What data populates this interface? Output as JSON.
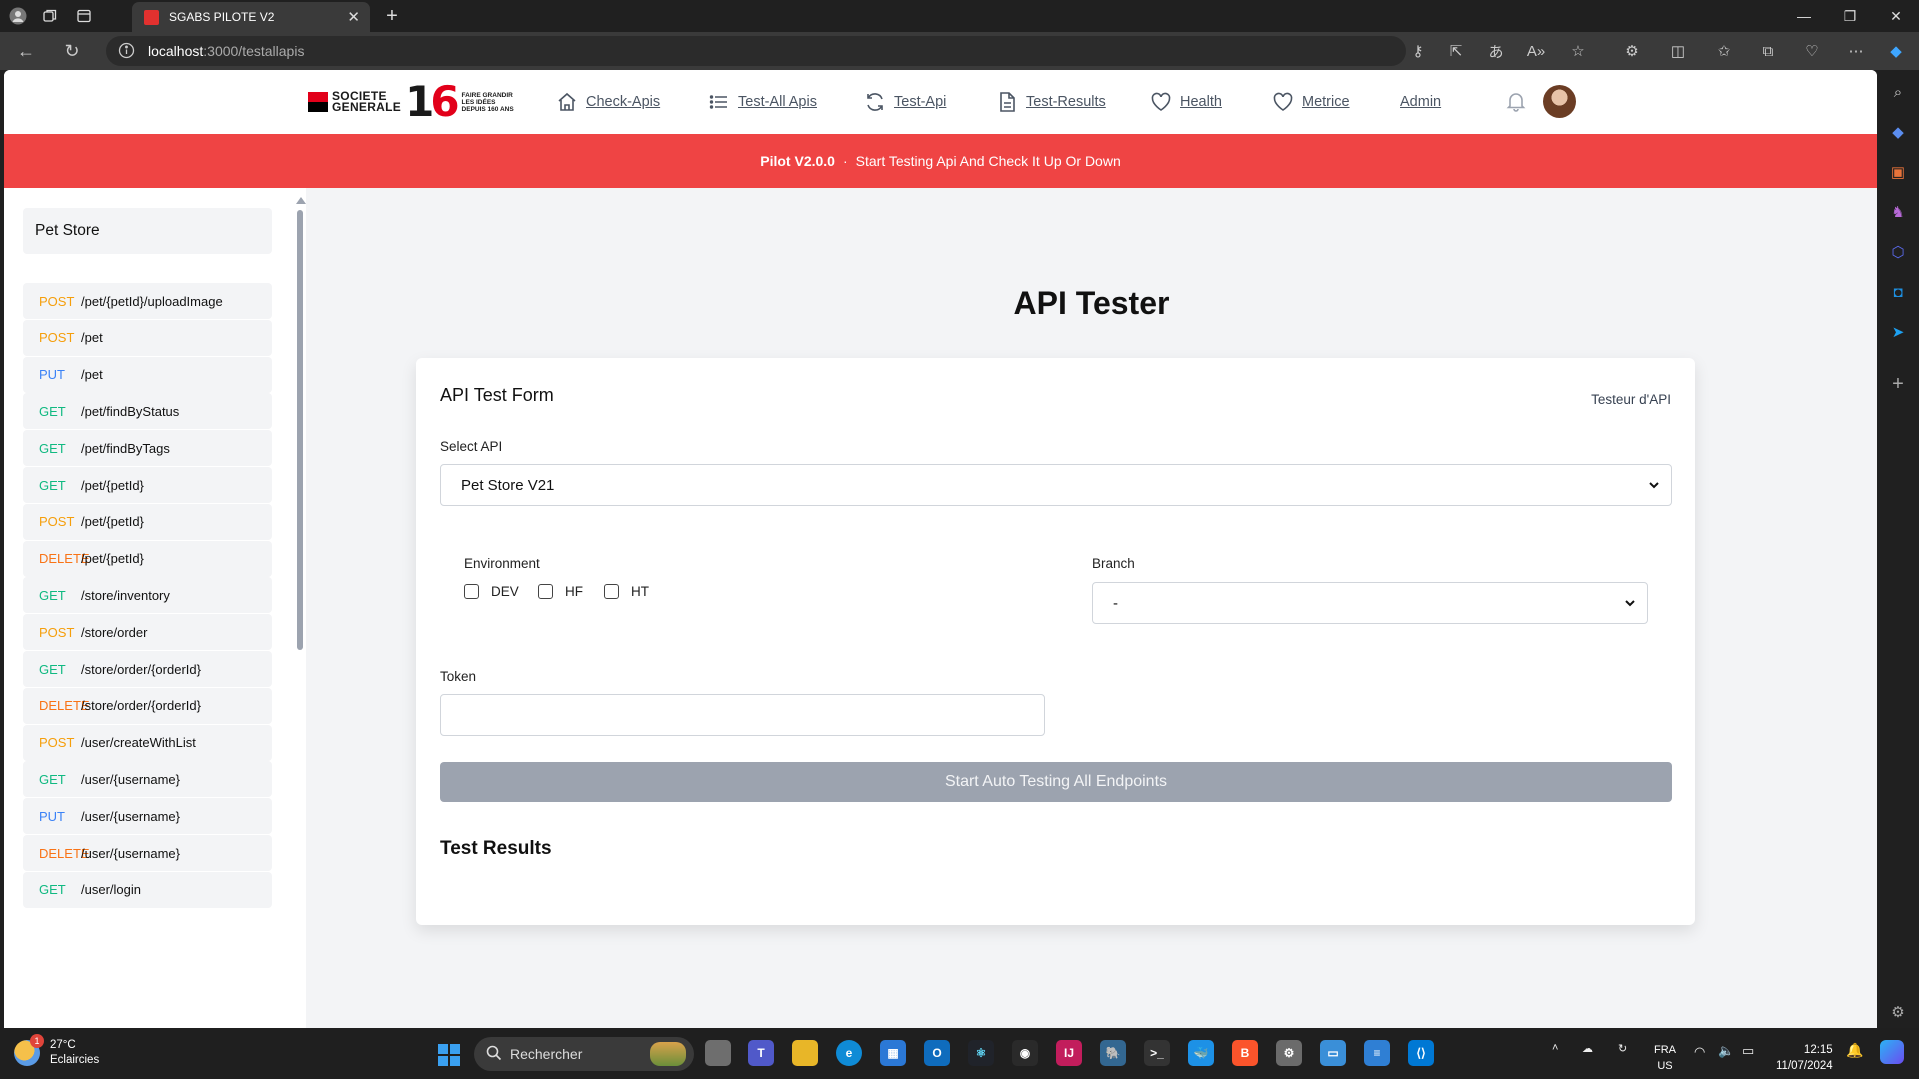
{
  "browser": {
    "tab_title": "SGABS PILOTE V2",
    "url_host": "localhost",
    "url_path": ":3000/testallapis"
  },
  "nav": {
    "logo_line1": "SOCIETE",
    "logo_line2": "GENERALE",
    "logo_number_1": "1",
    "logo_number_6": "6",
    "logo_sub1": "FAIRE GRANDIR",
    "logo_sub2": "LES IDÉES",
    "logo_sub3": "DEPUIS 160 ANS",
    "links": [
      {
        "label": "Check-Apis",
        "icon": "home-icon"
      },
      {
        "label": "Test-All Apis",
        "icon": "list-icon"
      },
      {
        "label": "Test-Api",
        "icon": "refresh-icon"
      },
      {
        "label": "Test-Results",
        "icon": "document-icon"
      },
      {
        "label": "Health",
        "icon": "heart-icon"
      },
      {
        "label": "Metrice",
        "icon": "heart-icon"
      },
      {
        "label": "Admin",
        "icon": ""
      }
    ]
  },
  "banner": {
    "version": "Pilot V2.0.0",
    "separator": "·",
    "message": "Start Testing Api And Check It Up Or Down"
  },
  "sidebar": {
    "title": "Pet Store",
    "endpoints": [
      {
        "method": "POST",
        "path": "/pet/{petId}/uploadImage"
      },
      {
        "method": "POST",
        "path": "/pet"
      },
      {
        "method": "PUT",
        "path": "/pet"
      },
      {
        "method": "GET",
        "path": "/pet/findByStatus"
      },
      {
        "method": "GET",
        "path": "/pet/findByTags"
      },
      {
        "method": "GET",
        "path": "/pet/{petId}"
      },
      {
        "method": "POST",
        "path": "/pet/{petId}"
      },
      {
        "method": "DELETE",
        "path": "/pet/{petId}"
      },
      {
        "method": "GET",
        "path": "/store/inventory"
      },
      {
        "method": "POST",
        "path": "/store/order"
      },
      {
        "method": "GET",
        "path": "/store/order/{orderId}"
      },
      {
        "method": "DELETE",
        "path": "/store/order/{orderId}"
      },
      {
        "method": "POST",
        "path": "/user/createWithList"
      },
      {
        "method": "GET",
        "path": "/user/{username}"
      },
      {
        "method": "PUT",
        "path": "/user/{username}"
      },
      {
        "method": "DELETE",
        "path": "/user/{username}"
      },
      {
        "method": "GET",
        "path": "/user/login"
      }
    ]
  },
  "main": {
    "title": "API Tester",
    "form": {
      "title": "API Test Form",
      "subtitle": "Testeur d'API",
      "select_api_label": "Select API",
      "select_api_value": "Pet Store V21",
      "environment_label": "Environment",
      "environments": [
        {
          "label": "DEV",
          "checked": false
        },
        {
          "label": "HF",
          "checked": false
        },
        {
          "label": "HT",
          "checked": false
        }
      ],
      "branch_label": "Branch",
      "branch_value": "-",
      "token_label": "Token",
      "token_value": "",
      "start_button": "Start Auto Testing All Endpoints",
      "results_title": "Test Results"
    }
  },
  "taskbar": {
    "weather_temp": "27°C",
    "weather_desc": "Eclaircies",
    "weather_badge": "1",
    "search_placeholder": "Rechercher",
    "lang_line1": "FRA",
    "lang_line2": "US",
    "time": "12:15",
    "date": "11/07/2024"
  },
  "colors": {
    "banner": "#ef4444",
    "post": "#f59e0b",
    "put": "#3b82f6",
    "get": "#10b981",
    "delete": "#f97316",
    "start_button": "#9ca3af"
  }
}
